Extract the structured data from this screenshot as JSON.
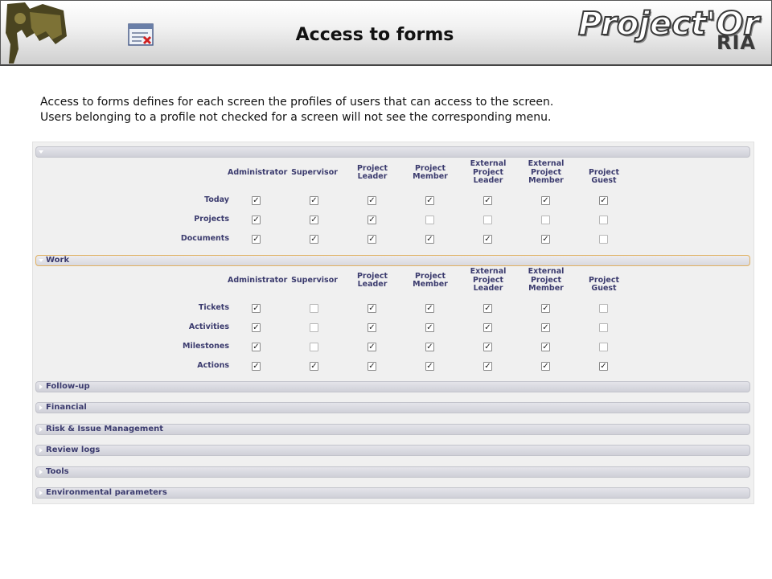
{
  "banner": {
    "title": "Access to forms",
    "brand": "Project'Or",
    "brand_sub": "RIA",
    "left_logo_icon": "projector-logo-icon",
    "form_icon": "form-access-icon"
  },
  "intro": {
    "line1": "Access to forms defines for each screen the profiles of users that can access to the screen.",
    "line2": "Users belonging to a profile not checked for a screen will not see the corresponding menu."
  },
  "columns": [
    "Administrator",
    "Supervisor",
    "Project Leader",
    "Project Member",
    "External Project Leader",
    "External Project Member",
    "Project Guest"
  ],
  "sections": [
    {
      "label": "",
      "expanded": true,
      "rows": [
        {
          "label": "Today",
          "checks": [
            true,
            true,
            true,
            true,
            true,
            true,
            true
          ]
        },
        {
          "label": "Projects",
          "checks": [
            true,
            true,
            true,
            false,
            false,
            false,
            false
          ]
        },
        {
          "label": "Documents",
          "checks": [
            true,
            true,
            true,
            true,
            true,
            true,
            false
          ]
        }
      ]
    },
    {
      "label": "Work",
      "expanded": true,
      "rows": [
        {
          "label": "Tickets",
          "checks": [
            true,
            false,
            true,
            true,
            true,
            true,
            false
          ]
        },
        {
          "label": "Activities",
          "checks": [
            true,
            false,
            true,
            true,
            true,
            true,
            false
          ]
        },
        {
          "label": "Milestones",
          "checks": [
            true,
            false,
            true,
            true,
            true,
            true,
            false
          ]
        },
        {
          "label": "Actions",
          "checks": [
            true,
            true,
            true,
            true,
            true,
            true,
            true
          ]
        }
      ]
    },
    {
      "label": "Follow-up",
      "expanded": false,
      "rows": []
    },
    {
      "label": "Financial",
      "expanded": false,
      "rows": []
    },
    {
      "label": "Risk & Issue Management",
      "expanded": false,
      "rows": []
    },
    {
      "label": "Review logs",
      "expanded": false,
      "rows": []
    },
    {
      "label": "Tools",
      "expanded": false,
      "rows": []
    },
    {
      "label": "Environmental parameters",
      "expanded": false,
      "rows": []
    }
  ],
  "colors": {
    "label_text": "#3b3b6e",
    "section_border_active": "#e0b060"
  }
}
